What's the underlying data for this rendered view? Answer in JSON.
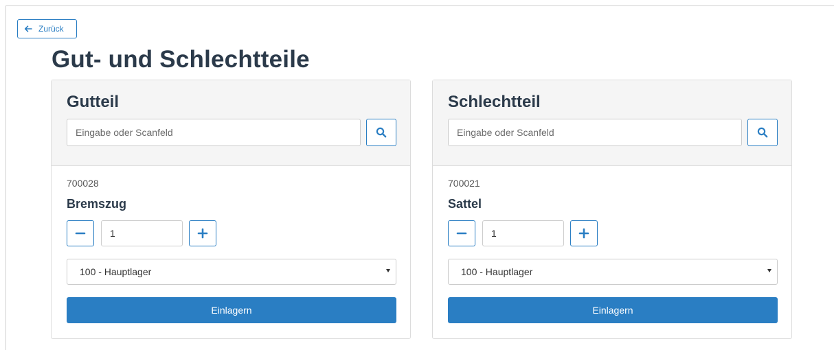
{
  "nav": {
    "back_label": "Zurück"
  },
  "page": {
    "title": "Gut- und Schlechtteile"
  },
  "panels": [
    {
      "title": "Gutteil",
      "search_placeholder": "Eingabe oder Scanfeld",
      "item_number": "700028",
      "item_name": "Bremszug",
      "quantity": "1",
      "location": "100 - Hauptlager",
      "submit_label": "Einlagern"
    },
    {
      "title": "Schlechtteil",
      "search_placeholder": "Eingabe oder Scanfeld",
      "item_number": "700021",
      "item_name": "Sattel",
      "quantity": "1",
      "location": "100 - Hauptlager",
      "submit_label": "Einlagern"
    }
  ],
  "icons": {
    "back": "arrow-left-icon",
    "search": "search-icon",
    "minus": "minus-icon",
    "plus": "plus-icon",
    "caret": "caret-down-icon"
  },
  "colors": {
    "accent": "#2a7ec3",
    "title": "#2b3a4a",
    "header_bg": "#f5f5f5"
  }
}
